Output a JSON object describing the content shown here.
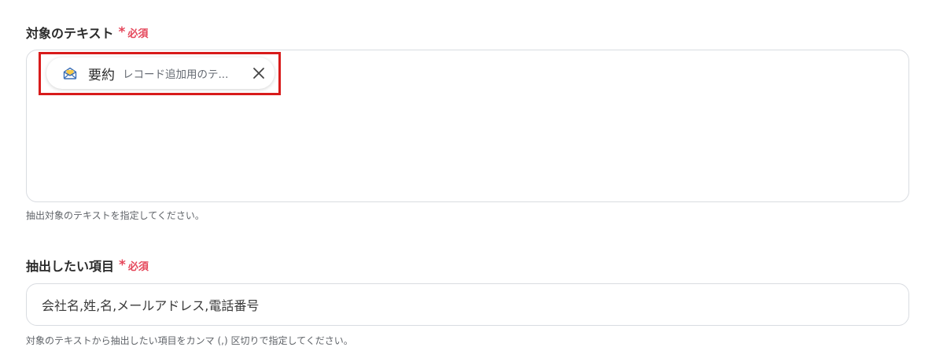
{
  "field1": {
    "label": "対象のテキスト",
    "required_star": "*",
    "required_text": "必須",
    "chip": {
      "icon": "mail-summary-icon",
      "name": "要約",
      "value": "レコード追加用のテ...",
      "close_icon": "close-icon"
    },
    "hint": "抽出対象のテキストを指定してください。"
  },
  "field2": {
    "label": "抽出したい項目",
    "required_star": "*",
    "required_text": "必須",
    "value": "会社名,姓,名,メールアドレス,電話番号",
    "hint": "対象のテキストから抽出したい項目をカンマ (,) 区切りで指定してください。"
  },
  "colors": {
    "required": "#e5465a",
    "highlight": "#d81b1b",
    "border": "#d9dce1"
  }
}
